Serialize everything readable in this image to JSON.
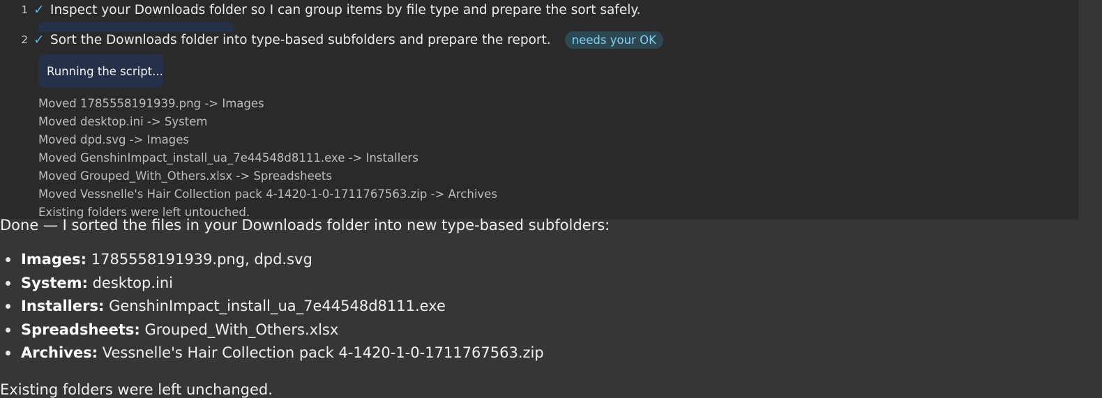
{
  "steps": [
    {
      "number": "1",
      "check": "✓",
      "text": "Inspect your Downloads folder so I can group items by file type and prepare the sort safely."
    },
    {
      "number": "2",
      "check": "✓",
      "text": "Sort the Downloads folder into type-based subfolders and prepare the report.",
      "badge": "needs your OK"
    }
  ],
  "running_label": "Running the script...",
  "log": [
    "Moved 1785558191939.png -> Images",
    "Moved desktop.ini -> System",
    "Moved dpd.svg -> Images",
    "Moved GenshinImpact_install_ua_7e44548d8111.exe -> Installers",
    "Moved Grouped_With_Others.xlsx -> Spreadsheets",
    "Moved Vessnelle's Hair Collection pack 4-1420-1-0-1711767563.zip -> Archives",
    "Existing folders were left untouched."
  ],
  "response": {
    "intro": "Done — I sorted the files in your Downloads folder into new type-based subfolders:",
    "items": [
      {
        "category": "Images:",
        "files": "1785558191939.png, dpd.svg"
      },
      {
        "category": "System:",
        "files": "desktop.ini"
      },
      {
        "category": "Installers:",
        "files": "GenshinImpact_install_ua_7e44548d8111.exe"
      },
      {
        "category": "Spreadsheets:",
        "files": "Grouped_With_Others.xlsx"
      },
      {
        "category": "Archives:",
        "files": "Vessnelle's Hair Collection pack 4-1420-1-0-1711767563.zip"
      }
    ],
    "outro": "Existing folders were left unchanged."
  },
  "colors": {
    "page_bg": "#363636",
    "panel_bg": "#2a2a2a",
    "check": "#58b8ee",
    "badge_bg": "#2d4852",
    "badge_text": "#7fd1f2",
    "running_pill_bg": "#243149"
  }
}
